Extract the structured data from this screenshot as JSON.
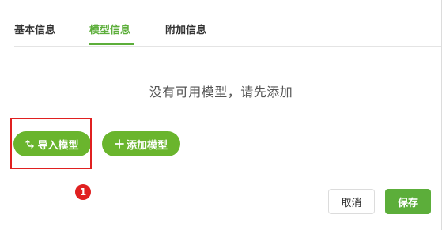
{
  "tabs": [
    {
      "label": "基本信息",
      "active": false
    },
    {
      "label": "模型信息",
      "active": true
    },
    {
      "label": "附加信息",
      "active": false
    }
  ],
  "empty_message": "没有可用模型，请先添加",
  "actions": {
    "import_label": "导入模型",
    "import_icon": "import-arrow-icon",
    "add_label": "添加模型",
    "add_icon": "plus-icon"
  },
  "annotation": {
    "badge_number": "1"
  },
  "footer": {
    "cancel_label": "取消",
    "save_label": "保存"
  },
  "colors": {
    "accent": "#5cae3a",
    "button_green": "#6ab52d",
    "annotation_red": "#e02020"
  }
}
